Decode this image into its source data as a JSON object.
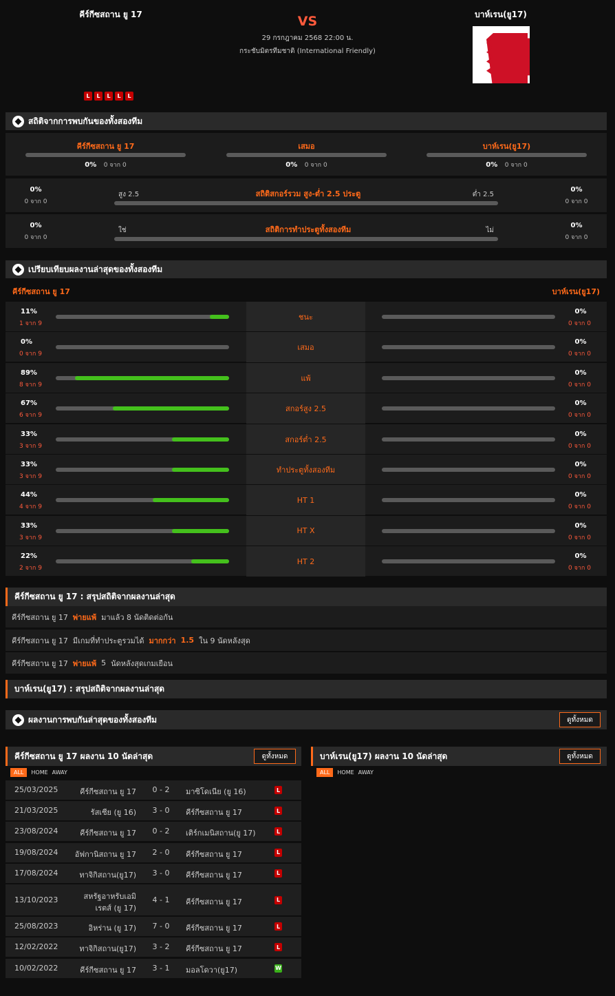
{
  "header": {
    "home_team": "คีร์กีซสถาน ยู 17",
    "away_team": "บาห์เรน(ยู17)",
    "vs": "VS",
    "datetime": "29 กรกฎาคม 2568 22:00 น.",
    "competition": "กระชับมิตรทีมชาติ (International Friendly)",
    "home_form": [
      "L",
      "L",
      "L",
      "L",
      "L"
    ]
  },
  "h2h": {
    "title": "สถิติจากการพบกันของทั้งสองทีม",
    "home_label": "คีร์กีซสถาน ยู 17",
    "draw_label": "เสมอ",
    "away_label": "บาห์เรน(ยู17)",
    "home_pct": "0%",
    "home_of": "0 จาก 0",
    "draw_pct": "0%",
    "draw_of": "0 จาก 0",
    "away_pct": "0%",
    "away_of": "0 จาก 0"
  },
  "ou": {
    "title": "สถิติสกอร์รวม สูง-ต่ำ 2.5 ประตู",
    "left_label": "สูง 2.5",
    "right_label": "ต่ำ 2.5",
    "left_pct": "0%",
    "left_of": "0 จาก 0",
    "right_pct": "0%",
    "right_of": "0 จาก 0"
  },
  "btts": {
    "title": "สถิติการทำประตูทั้งสองทีม",
    "left_label": "ใช่",
    "right_label": "ไม่",
    "left_pct": "0%",
    "left_of": "0 จาก 0",
    "right_pct": "0%",
    "right_of": "0 จาก 0"
  },
  "compare": {
    "title": "เปรียบเทียบผลงานล่าสุดของทั้งสองทีม",
    "home": "คีร์กีซสถาน ยู 17",
    "away": "บาห์เรน(ยู17)",
    "rows": [
      {
        "label": "ชนะ",
        "hp": "11%",
        "hof": "1 จาก 9",
        "hv": 0.11,
        "ap": "0%",
        "aof": "0 จาก 0"
      },
      {
        "label": "เสมอ",
        "hp": "0%",
        "hof": "0 จาก 9",
        "hv": 0,
        "ap": "0%",
        "aof": "0 จาก 0"
      },
      {
        "label": "แพ้",
        "hp": "89%",
        "hof": "8 จาก 9",
        "hv": 0.89,
        "ap": "0%",
        "aof": "0 จาก 0"
      },
      {
        "label": "สกอร์สูง 2.5",
        "hp": "67%",
        "hof": "6 จาก 9",
        "hv": 0.67,
        "ap": "0%",
        "aof": "0 จาก 0"
      },
      {
        "label": "สกอร์ต่ำ 2.5",
        "hp": "33%",
        "hof": "3 จาก 9",
        "hv": 0.33,
        "ap": "0%",
        "aof": "0 จาก 0"
      },
      {
        "label": "ทำประตูทั้งสองทีม",
        "hp": "33%",
        "hof": "3 จาก 9",
        "hv": 0.33,
        "ap": "0%",
        "aof": "0 จาก 0"
      },
      {
        "label": "HT 1",
        "hp": "44%",
        "hof": "4 จาก 9",
        "hv": 0.44,
        "ap": "0%",
        "aof": "0 จาก 0"
      },
      {
        "label": "HT X",
        "hp": "33%",
        "hof": "3 จาก 9",
        "hv": 0.33,
        "ap": "0%",
        "aof": "0 จาก 0"
      },
      {
        "label": "HT 2",
        "hp": "22%",
        "hof": "2 จาก 9",
        "hv": 0.22,
        "ap": "0%",
        "aof": "0 จาก 0"
      }
    ]
  },
  "summary_home": {
    "title": "คีร์กีซสถาน ยู 17 : สรุปสถิติจากผลงานล่าสุด",
    "l1a": "คีร์กีซสถาน ยู 17",
    "l1b": "พ่ายแพ้",
    "l1c": "มาแล้ว 8 นัดติดต่อกัน",
    "l2a": "คีร์กีซสถาน ยู 17",
    "l2b": "มีเกมที่ทำประตูรวมได้",
    "l2c": "มากกว่า",
    "l2d": "1.5",
    "l2e": "ใน 9 นัดหลังสุด",
    "l3a": "คีร์กีซสถาน ยู 17",
    "l3b": "พ่ายแพ้",
    "l3c": "5",
    "l3d": "นัดหลังสุดเกมเยือน"
  },
  "summary_away": {
    "title": "บาห์เรน(ยู17) : สรุปสถิติจากผลงานล่าสุด"
  },
  "recent_h2h": {
    "title": "ผลงานการพบกันล่าสุดของทั้งสองทีม",
    "btn": "ดูทั้งหมด"
  },
  "home_last": {
    "title": "คีร์กีซสถาน ยู 17 ผลงาน 10 นัดล่าสุด",
    "btn": "ดูทั้งหมด",
    "tabs": [
      "ALL",
      "HOME",
      "AWAY"
    ],
    "matches": [
      {
        "date": "25/03/2025",
        "home": "คีร์กีซสถาน ยู 17",
        "score": "0 - 2",
        "away": "มาซิโดเนีย (ยู 16)",
        "res": "L"
      },
      {
        "date": "21/03/2025",
        "home": "รัสเซีย (ยู 16)",
        "score": "3 - 0",
        "away": "คีร์กีซสถาน ยู 17",
        "res": "L"
      },
      {
        "date": "23/08/2024",
        "home": "คีร์กีซสถาน ยู 17",
        "score": "0 - 2",
        "away": "เติร์กเมนิสถาน(ยู 17)",
        "res": "L"
      },
      {
        "date": "19/08/2024",
        "home": "อัฟกานิสถาน ยู 17",
        "score": "2 - 0",
        "away": "คีร์กีซสถาน ยู 17",
        "res": "L"
      },
      {
        "date": "17/08/2024",
        "home": "ทาจิกิสถาน(ยู17)",
        "score": "3 - 0",
        "away": "คีร์กีซสถาน ยู 17",
        "res": "L"
      },
      {
        "date": "13/10/2023",
        "home": "สหรัฐอาหรับเอมิ",
        "home2": "เรตส์ (ยู 17)",
        "score": "4 - 1",
        "away": "คีร์กีซสถาน ยู 17",
        "res": "L"
      },
      {
        "date": "25/08/2023",
        "home": "อิหร่าน (ยู 17)",
        "score": "7 - 0",
        "away": "คีร์กีซสถาน ยู 17",
        "res": "L"
      },
      {
        "date": "12/02/2022",
        "home": "ทาจิกิสถาน(ยู17)",
        "score": "3 - 2",
        "away": "คีร์กีซสถาน ยู 17",
        "res": "L"
      },
      {
        "date": "10/02/2022",
        "home": "คีร์กีซสถาน ยู 17",
        "score": "3 - 1",
        "away": "มอลโดวา(ยู17)",
        "res": "W"
      }
    ]
  },
  "away_last": {
    "title": "บาห์เรน(ยู17) ผลงาน 10 นัดล่าสุด",
    "btn": "ดูทั้งหมด",
    "tabs": [
      "ALL",
      "HOME",
      "AWAY"
    ]
  },
  "colors": {
    "accent": "#ff6a1a",
    "win": "#44c01c",
    "loss": "#c40000",
    "bahrain_red": "#ce1126"
  }
}
